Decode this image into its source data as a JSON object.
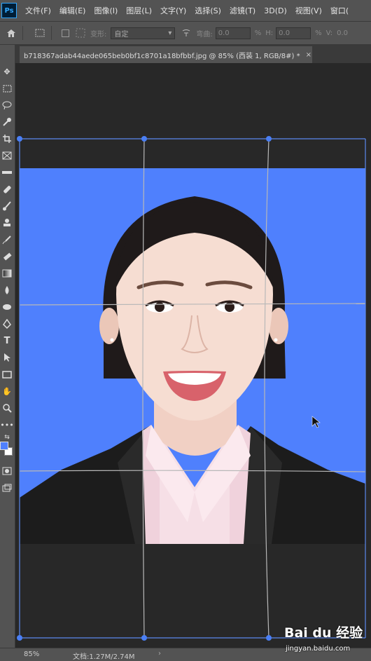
{
  "app": {
    "logo": "Ps"
  },
  "menu": {
    "items": [
      "文件(F)",
      "编辑(E)",
      "图像(I)",
      "图层(L)",
      "文字(Y)",
      "选择(S)",
      "滤镜(T)",
      "3D(D)",
      "视图(V)",
      "窗口("
    ]
  },
  "options": {
    "warp_label": "变形:",
    "warp_value": "自定",
    "w_label": "弯曲:",
    "w_value": "0.0",
    "percent": "%",
    "h_label": "H:",
    "h_value": "0.0",
    "v_label": "V:",
    "v_value": "0.0"
  },
  "document": {
    "tab_title": "b718367adab44aede065beb0bf1c8701a18bfbbf.jpg @ 85% (西装 1, RGB/8#) *",
    "close": "×"
  },
  "status": {
    "zoom": "85%",
    "doc_size": "文档:1.27M/2.74M",
    "arrow": "›"
  },
  "watermark": {
    "brand": "Bai du 经验",
    "url": "jingyan.baidu.com"
  },
  "colors": {
    "background_blue": "#4f80fd",
    "warp_grid": "#8fa7d0",
    "handle": "#4a7ff5",
    "suit": "#1c1c1c",
    "shirt": "#f0d2dc"
  },
  "icons": {
    "home": "home-icon",
    "move": "move-tool-icon",
    "marquee": "marquee-tool-icon",
    "lasso": "lasso-tool-icon",
    "crop": "crop-tool-icon",
    "type": "type-tool-icon",
    "hand": "hand-tool-icon",
    "zoom": "zoom-tool-icon"
  }
}
